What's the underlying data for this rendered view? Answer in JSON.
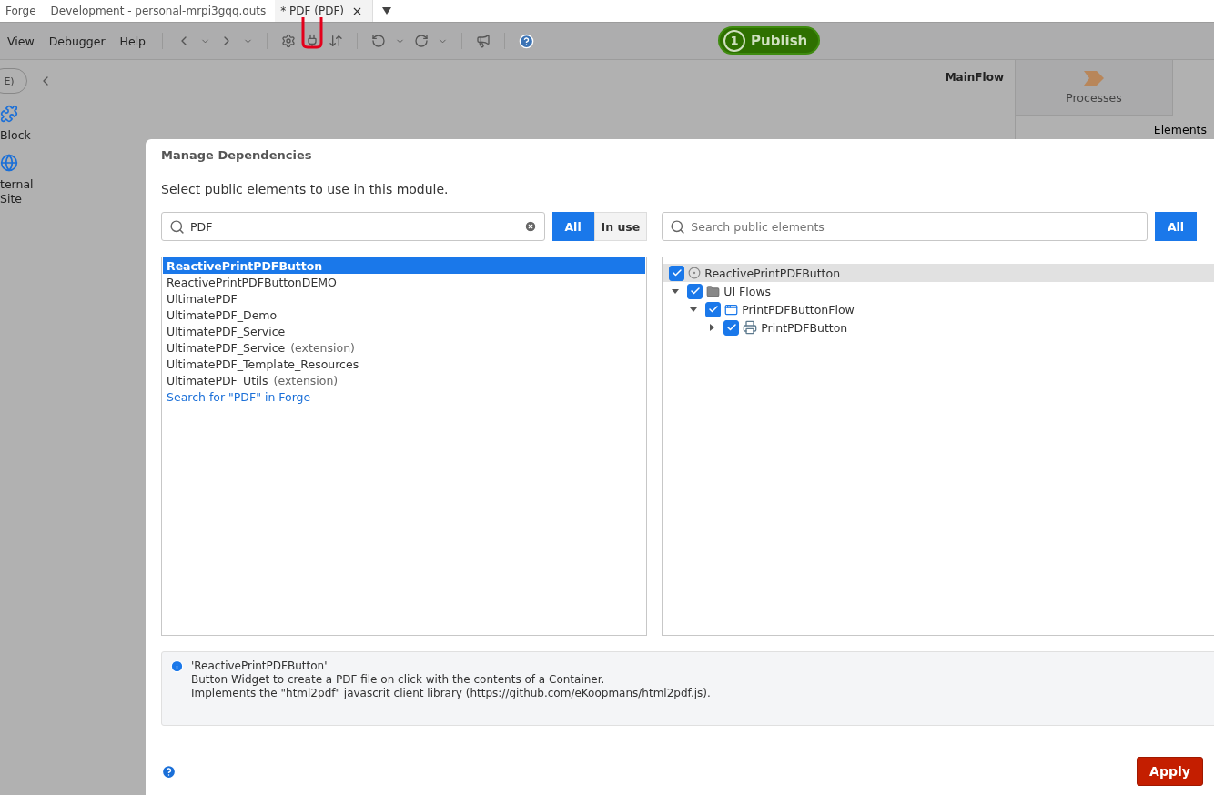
{
  "tabs": [
    {
      "label": "Forge",
      "selected": false,
      "closable": false
    },
    {
      "label": "Development - personal-mrpi3gqq.outs",
      "selected": false,
      "closable": false
    },
    {
      "label": "* PDF (PDF)",
      "selected": true,
      "closable": true
    }
  ],
  "toolbar": {
    "menus": [
      "View",
      "Debugger",
      "Help"
    ],
    "publish": {
      "count": "1",
      "label": "Publish"
    }
  },
  "sidebar": {
    "search_pill": "E)",
    "items": [
      {
        "kind": "puzzle",
        "label": "Block"
      },
      {
        "kind": "globe",
        "label": "ternal Site"
      }
    ]
  },
  "canvas": {
    "flow_title": "MainFlow"
  },
  "right_panel": {
    "tile": "Processes",
    "section": "Elements"
  },
  "dialog": {
    "title": "Manage Dependencies",
    "instruction": "Select public elements to use in this module.",
    "modules": {
      "search_value": "PDF",
      "filters": [
        {
          "label": "All",
          "selected": true
        },
        {
          "label": "In use",
          "selected": false
        }
      ],
      "items": [
        {
          "kind": "module",
          "name": "ReactivePrintPDFButton",
          "selected": true
        },
        {
          "kind": "module",
          "name": "ReactivePrintPDFButtonDEMO",
          "selected": false
        },
        {
          "kind": "module",
          "name": "UltimatePDF",
          "selected": false
        },
        {
          "kind": "module",
          "name": "UltimatePDF_Demo",
          "selected": false
        },
        {
          "kind": "module",
          "name": "UltimatePDF_Service",
          "selected": false
        },
        {
          "kind": "module",
          "name": "UltimatePDF_Service",
          "note": "(extension)",
          "selected": false
        },
        {
          "kind": "module",
          "name": "UltimatePDF_Template_Resources",
          "selected": false
        },
        {
          "kind": "module",
          "name": "UltimatePDF_Utils",
          "note": "(extension)",
          "selected": false
        },
        {
          "kind": "link",
          "name": "Search for \"PDF\" in Forge",
          "selected": false
        }
      ]
    },
    "elements": {
      "search_placeholder": "Search public elements",
      "filters": [
        {
          "label": "All",
          "selected": true
        }
      ],
      "tree": [
        {
          "kind": "module",
          "label": "ReactivePrintPDFButton",
          "checked": true,
          "selected": true,
          "children": [
            {
              "kind": "folder",
              "label": "UI Flows",
              "checked": true,
              "selected": false,
              "expanded": true,
              "children": [
                {
                  "kind": "flow",
                  "label": "PrintPDFButtonFlow",
                  "checked": true,
                  "selected": false,
                  "expanded": true,
                  "children": [
                    {
                      "kind": "block",
                      "label": "PrintPDFButton",
                      "checked": true,
                      "selected": false,
                      "expanded": false
                    }
                  ]
                }
              ]
            }
          ]
        }
      ]
    },
    "info": [
      "'ReactivePrintPDFButton'",
      "Button Widget to create a PDF file on click with the contents of a Container.",
      "Implements the \"html2pdf\" javascrit client library (https://github.com/eKoopmans/html2pdf.js)."
    ],
    "apply": "Apply"
  }
}
